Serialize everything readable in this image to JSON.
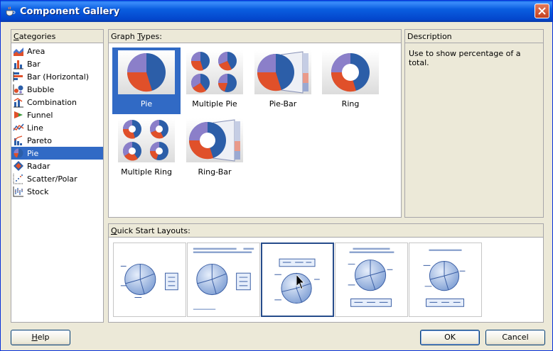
{
  "window": {
    "title": "Component Gallery",
    "app_icon": "coffee-cup-icon",
    "close_icon": "close-icon"
  },
  "categories": {
    "header_mnemonic": "C",
    "header_rest": "ategories",
    "selected_index": 8,
    "items": [
      {
        "label": "Area",
        "icon": "area-chart-icon"
      },
      {
        "label": "Bar",
        "icon": "bar-chart-icon"
      },
      {
        "label": "Bar (Horizontal)",
        "icon": "horizontal-bar-chart-icon"
      },
      {
        "label": "Bubble",
        "icon": "bubble-chart-icon"
      },
      {
        "label": "Combination",
        "icon": "combination-chart-icon"
      },
      {
        "label": "Funnel",
        "icon": "funnel-chart-icon"
      },
      {
        "label": "Line",
        "icon": "line-chart-icon"
      },
      {
        "label": "Pareto",
        "icon": "pareto-chart-icon"
      },
      {
        "label": "Pie",
        "icon": "pie-chart-icon"
      },
      {
        "label": "Radar",
        "icon": "radar-chart-icon"
      },
      {
        "label": "Scatter/Polar",
        "icon": "scatter-chart-icon"
      },
      {
        "label": "Stock",
        "icon": "stock-chart-icon"
      }
    ]
  },
  "graph_types": {
    "header_before": "Graph ",
    "header_mnemonic": "T",
    "header_after": "ypes:",
    "selected": "Pie",
    "items": [
      {
        "label": "Pie"
      },
      {
        "label": "Multiple Pie"
      },
      {
        "label": "Pie-Bar"
      },
      {
        "label": "Ring"
      },
      {
        "label": "Multiple Ring"
      },
      {
        "label": "Ring-Bar"
      }
    ]
  },
  "description": {
    "header": "Description",
    "text": "Use to show percentage of a total."
  },
  "quick_start": {
    "header_before": "",
    "header_mnemonic": "Q",
    "header_after": "uick Start Layouts:",
    "selected_index": 2,
    "count": 5
  },
  "buttons": {
    "help_mnemonic": "H",
    "help_rest": "elp",
    "ok": "OK",
    "cancel": "Cancel"
  },
  "colors": {
    "selection": "#316ac5",
    "pie_blue": "#2c5ea8",
    "pie_red": "#e0502a",
    "pie_purple": "#8b7fc9"
  }
}
